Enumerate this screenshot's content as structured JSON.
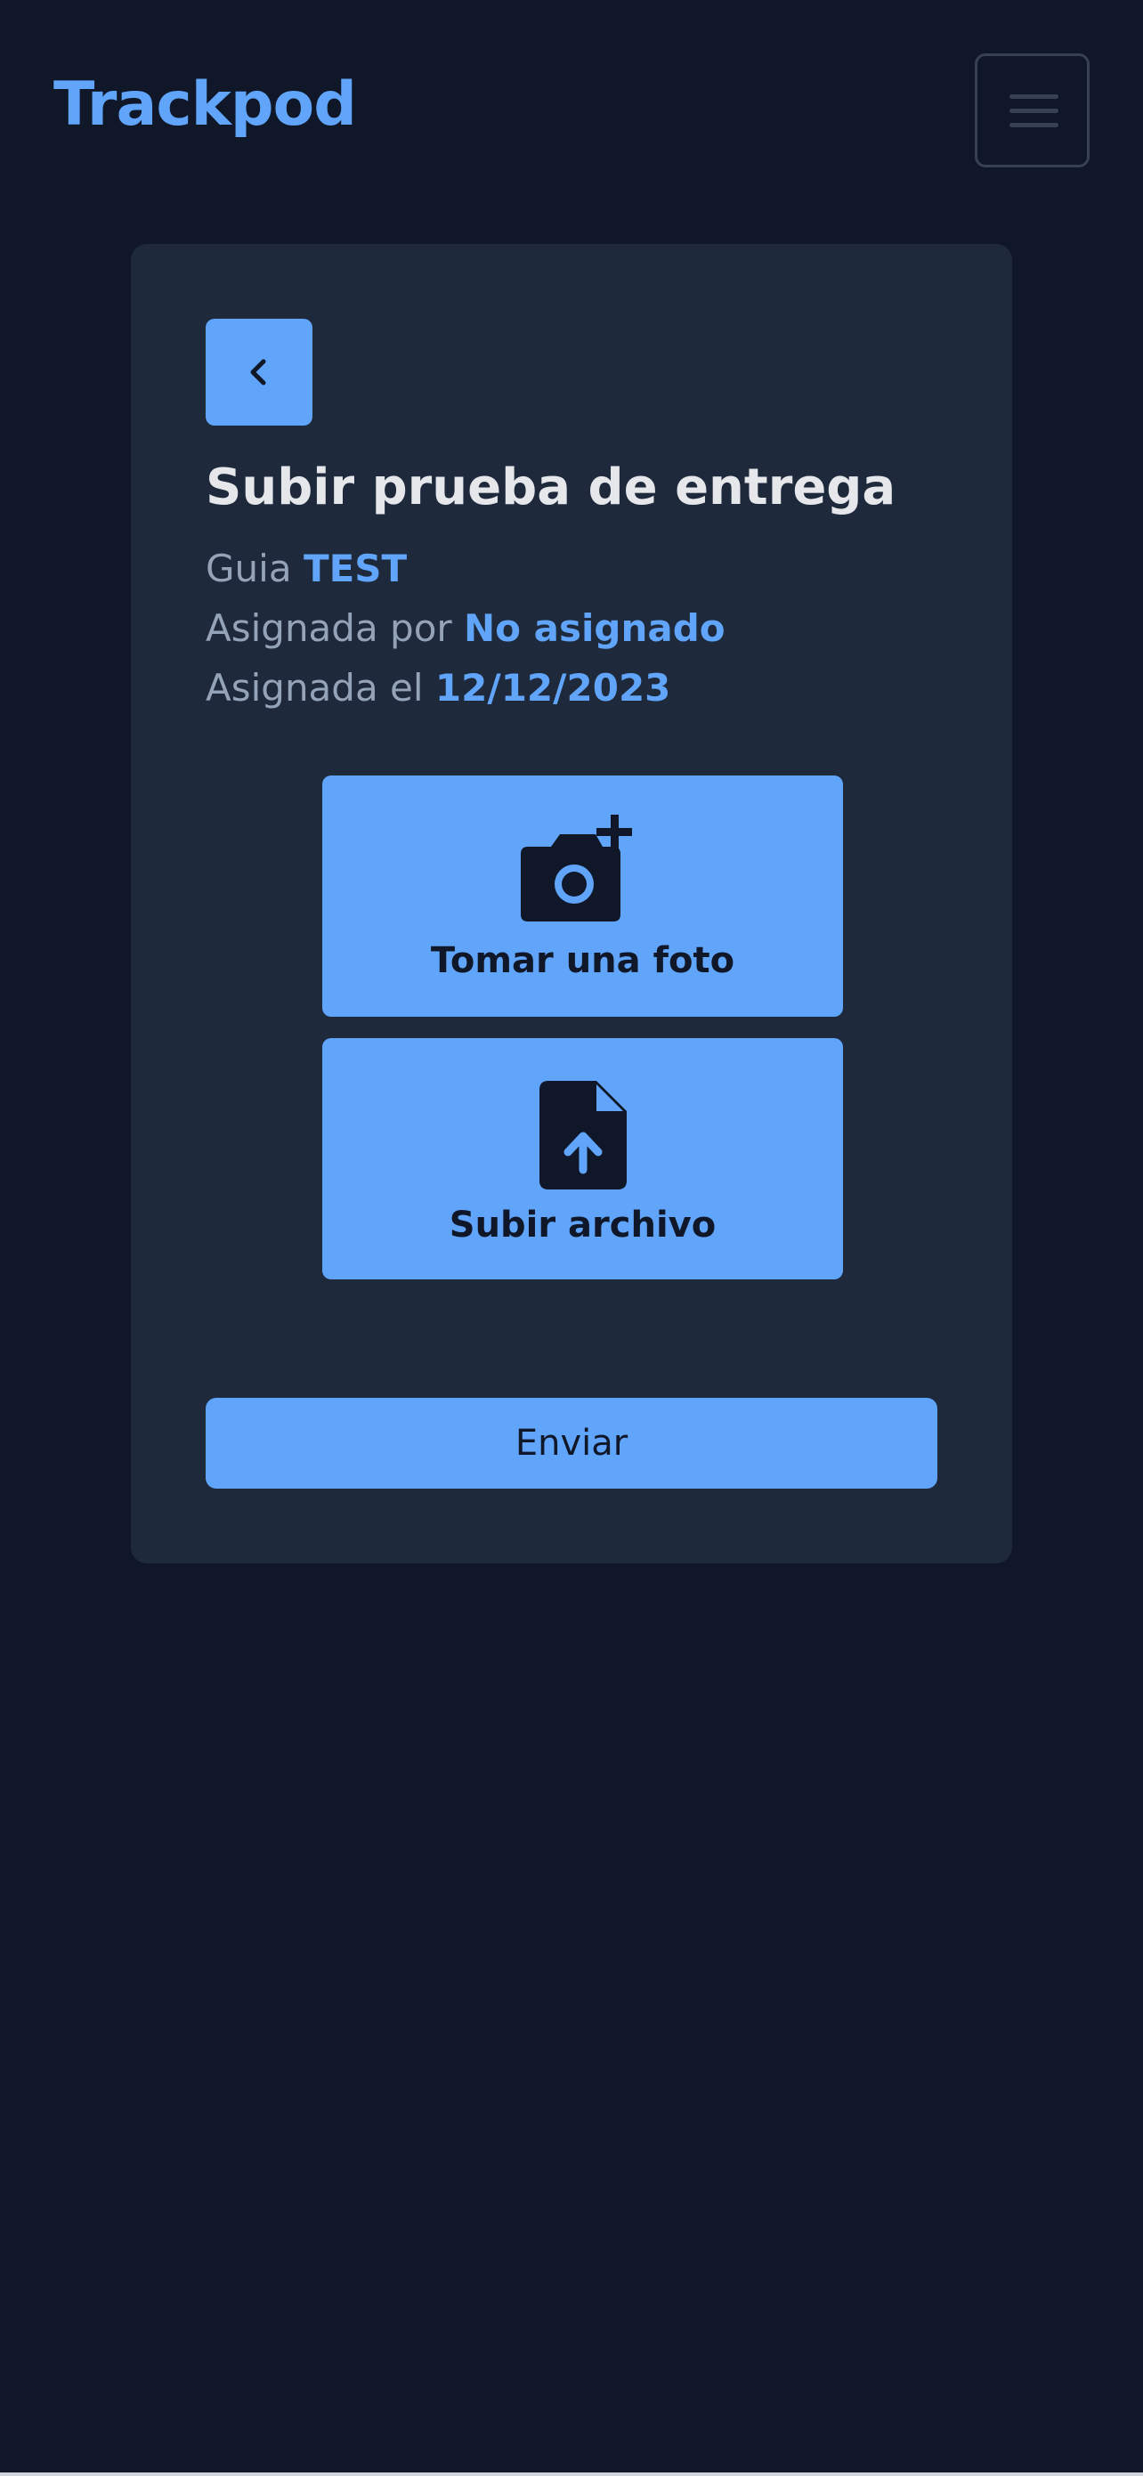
{
  "navbar": {
    "brand": "Trackpod",
    "menu_icon": "hamburger-menu-icon"
  },
  "card": {
    "back_icon": "chevron-left-icon",
    "title": "Subir prueba de entrega",
    "meta": [
      {
        "label": "Guia",
        "value": "TEST"
      },
      {
        "label": "Asignada por",
        "value": "No asignado"
      },
      {
        "label": "Asignada el",
        "value": "12/12/2023"
      }
    ],
    "actions": [
      {
        "icon": "camera-plus-icon",
        "label": "Tomar una foto"
      },
      {
        "icon": "file-upload-icon",
        "label": "Subir archivo"
      }
    ],
    "submit_label": "Enviar"
  },
  "colors": {
    "background": "#0f1729",
    "card": "#1e293b",
    "accent": "#60a5fa",
    "title_text": "#e5e7eb",
    "muted_text": "#94a3b8",
    "border": "#374151"
  }
}
